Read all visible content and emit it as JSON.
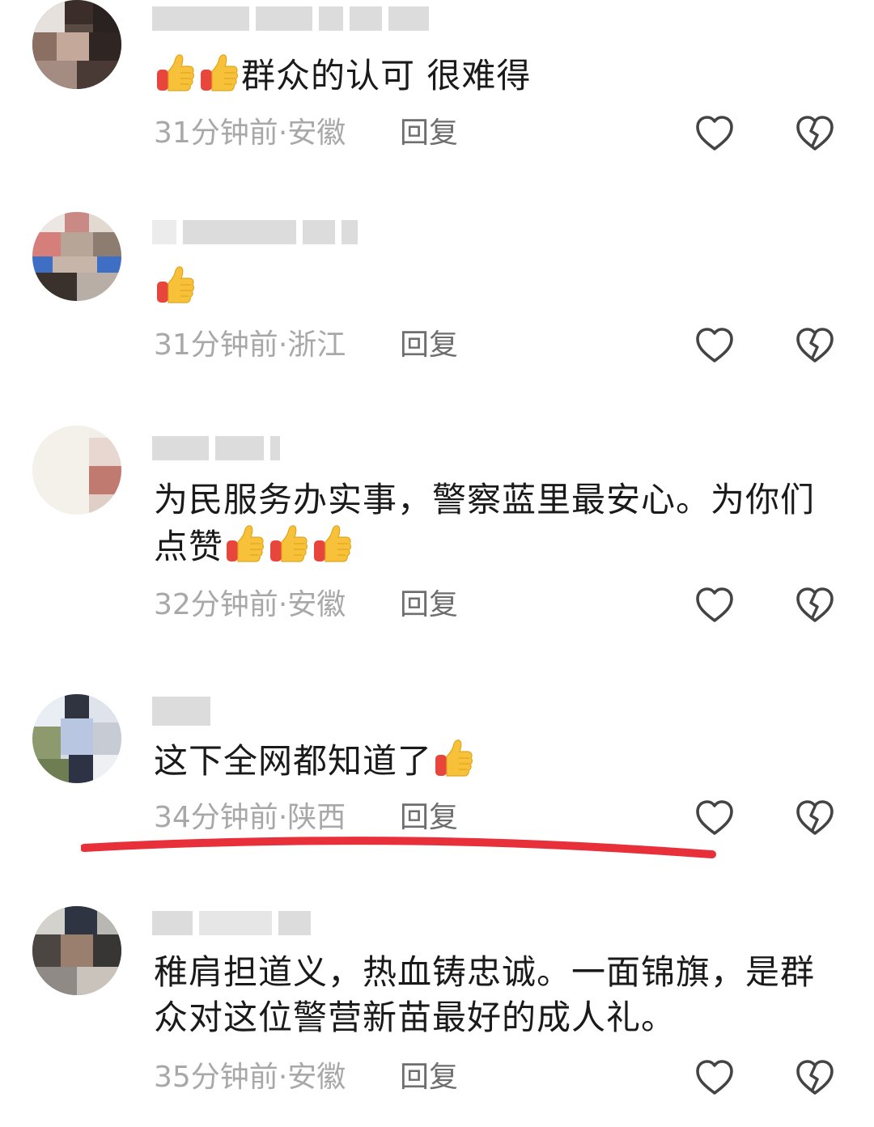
{
  "comments": [
    {
      "text_before": "",
      "text": "群众的认可  很难得",
      "emoji_prefix": 2,
      "emoji_suffix": 0,
      "time": "31分钟前",
      "location": "安徽",
      "reply_label": "回复"
    },
    {
      "text": "",
      "emoji_prefix": 1,
      "emoji_suffix": 0,
      "time": "31分钟前",
      "location": "浙江",
      "reply_label": "回复"
    },
    {
      "text_line1": "为民服务办实事，警察蓝里最安心。为你们",
      "text_line2": "点赞",
      "emoji_suffix": 3,
      "time": "32分钟前",
      "location": "安徽",
      "reply_label": "回复"
    },
    {
      "text": "这下全网都知道了",
      "emoji_suffix": 1,
      "time": "34分钟前",
      "location": "陕西",
      "reply_label": "回复"
    },
    {
      "text_line1": "稚肩担道义，热血铸忠诚。一面锦旗，是群",
      "text_line2": "众对这位警营新苗最好的成人礼。",
      "time": "35分钟前",
      "location": "安徽",
      "reply_label": "回复"
    }
  ],
  "separator": "·",
  "icons": {
    "like": "heart-outline-icon",
    "dislike": "broken-heart-outline-icon",
    "emoji": "thumbs-up-emoji"
  },
  "colors": {
    "text": "#1a1a1a",
    "meta": "#a8a8a8",
    "reply": "#6e6e6e",
    "underline": "#e8303b"
  }
}
